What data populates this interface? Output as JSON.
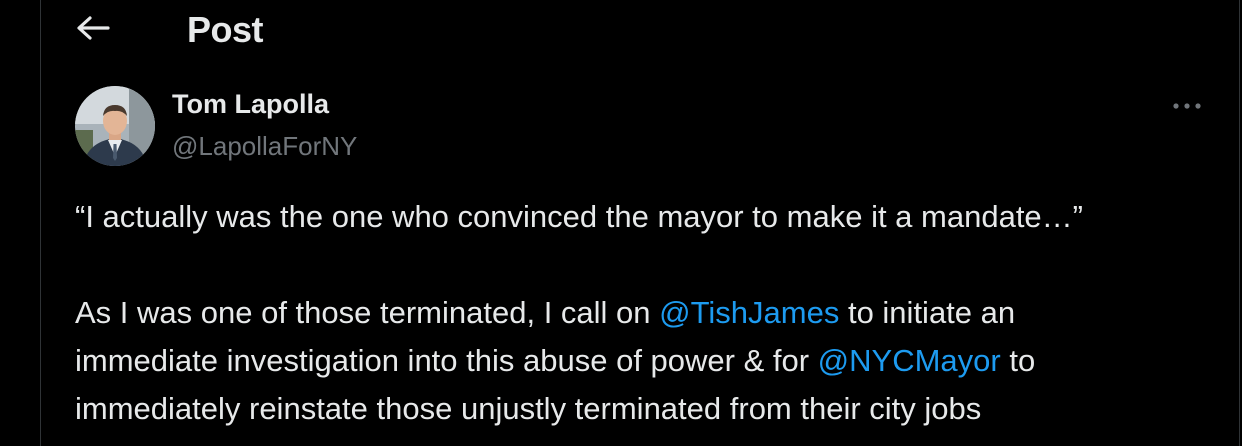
{
  "header": {
    "back_icon": "arrow-left-icon",
    "title": "Post"
  },
  "post": {
    "author": {
      "name": "Tom Lapolla",
      "handle": "@LapollaForNY",
      "avatar": "profile-photo"
    },
    "more_icon": "more-dots-icon",
    "paragraph_1": "“I actually was the one who convinced the mayor to make it a mandate…”",
    "paragraph_2": {
      "line_1_before": "As I was one of those terminated, I call on ",
      "mention_1": "@TishJames",
      "line_1_after": " to initiate an",
      "line_2_before": "immediate investigation into this abuse of power & for ",
      "mention_2": "@NYCMayor",
      "line_2_after": " to",
      "line_3": "immediately reinstate those unjustly terminated from their city jobs"
    }
  },
  "colors": {
    "background": "#000000",
    "text": "#e7e9ea",
    "secondary_text": "#71767b",
    "link": "#1d9bf0",
    "border": "#2f3336"
  }
}
